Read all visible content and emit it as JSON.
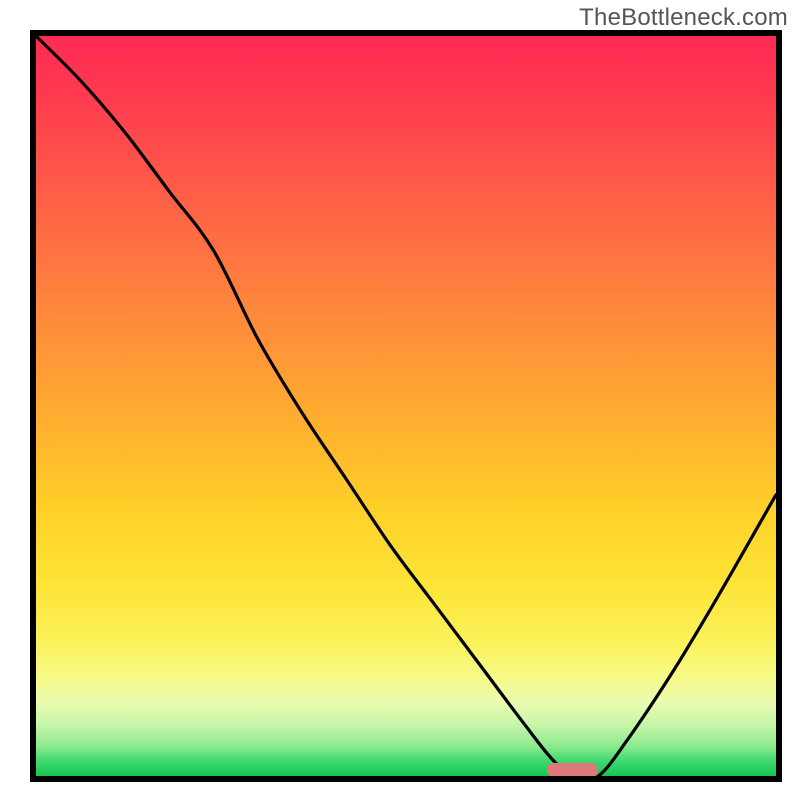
{
  "watermark": "TheBottleneck.com",
  "colors": {
    "frame": "#000000",
    "curve": "#000000",
    "marker": "#e07a7a",
    "gradient_top": "#ff2a55",
    "gradient_mid": "#fdd22a",
    "gradient_bottom": "#17c654"
  },
  "chart_data": {
    "type": "line",
    "title": "",
    "xlabel": "",
    "ylabel": "",
    "xlim": [
      0,
      100
    ],
    "ylim": [
      0,
      100
    ],
    "grid": false,
    "legend": false,
    "annotations": [
      {
        "text": "TheBottleneck.com",
        "position": "top-right"
      }
    ],
    "marker": {
      "x_start": 69,
      "x_end": 76,
      "y": 0.8
    },
    "series": [
      {
        "name": "bottleneck-curve",
        "x": [
          0,
          6,
          12,
          18,
          24,
          30,
          36,
          42,
          48,
          54,
          60,
          66,
          70,
          73,
          76,
          80,
          86,
          92,
          100
        ],
        "values": [
          100,
          94,
          87,
          79,
          71,
          59,
          49,
          40,
          31,
          23,
          15,
          7,
          2,
          0,
          0,
          5,
          14,
          24,
          38
        ]
      }
    ]
  }
}
